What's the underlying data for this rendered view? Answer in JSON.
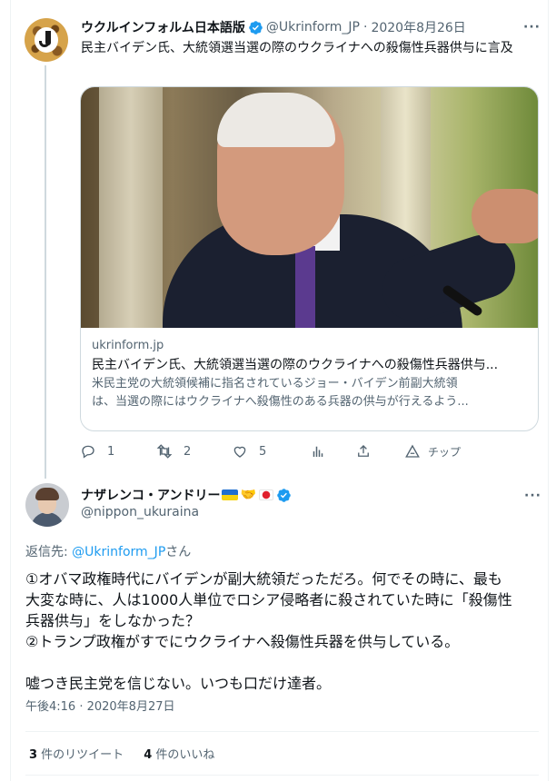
{
  "colors": {
    "accent": "#1d9bf0",
    "text": "#0f1419",
    "muted": "#536471",
    "border": "#cfd9de"
  },
  "tweet1": {
    "display_name": "ウクルインフォルム日本語版",
    "handle": "@Ukrinform_JP",
    "separator": "·",
    "date": "2020年8月26日",
    "text": "民主バイデン氏、大統領選当選の際のウクライナへの殺傷性兵器供与に言及",
    "card": {
      "domain": "ukrinform.jp",
      "title": "民主バイデン氏、大統領選当選の際のウクライナへの殺傷性兵器供与...",
      "desc_line1": "米民主党の大統領候補に指名されているジョー・バイデン前副大統領",
      "desc_line2": "は、当選の際にはウクライナへ殺傷性のある兵器の供与が行えるよう..."
    },
    "actions": {
      "reply_count": "1",
      "retweet_count": "2",
      "like_count": "5",
      "tip_label": "チップ"
    }
  },
  "tweet2": {
    "display_name": "ナザレンコ・アンドリー",
    "hand_emoji": "🤝",
    "handle": "@nippon_ukuraina",
    "reply_prefix": "返信先: ",
    "reply_handle": "@Ukrinform_JP",
    "reply_suffix": "さん",
    "text_lines": [
      "①オバマ政権時代にバイデンが副大統領だっただろ。何でその時に、最も",
      "大変な時に、人は1000人単位でロシア侵略者に殺されていた時に「殺傷性",
      "兵器供与」をしなかった？",
      "②トランプ政権がすでにウクライナへ殺傷性兵器を供与している。",
      "嘘つき民主党を信じない。いつも口だけ達者。"
    ],
    "timestamp": "午後4:16 · 2020年8月27日",
    "retweets_count": "3",
    "retweets_label": " 件のリツイート",
    "likes_count": "4",
    "likes_label": " 件のいいね"
  }
}
